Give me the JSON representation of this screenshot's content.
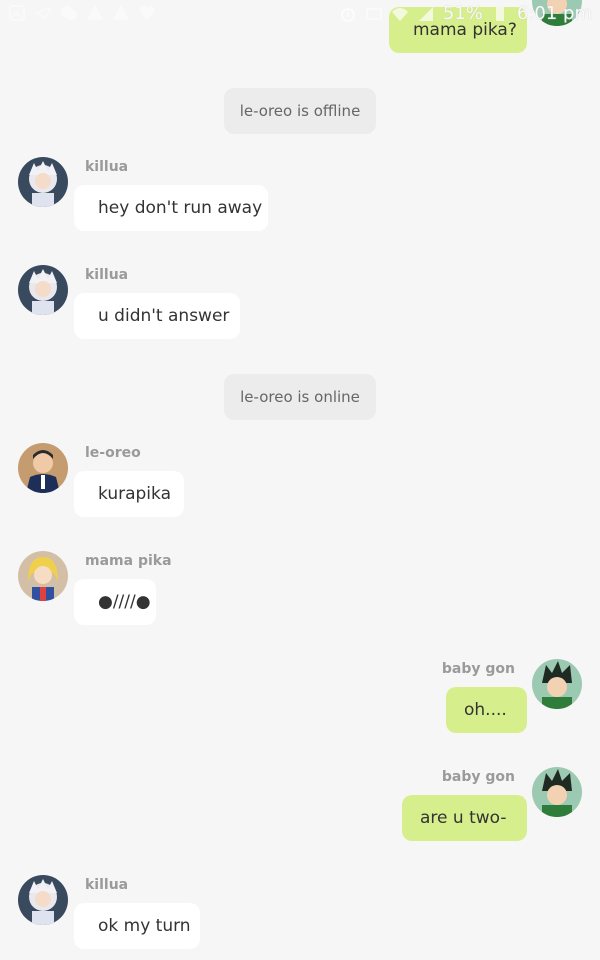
{
  "status_bar": {
    "battery": "51%",
    "time": "6:01 pm",
    "icons": [
      "gallery-icon",
      "messenger-icon",
      "chat-icon",
      "alert-icon",
      "alert-icon",
      "heart-icon",
      "alarm-icon",
      "lte-icon",
      "wifi-icon",
      "signal-icon",
      "battery-icon"
    ]
  },
  "messages": [
    {
      "kind": "outgoing",
      "text": "mama pika?",
      "avatar": "gon-avatar"
    },
    {
      "kind": "system",
      "text": "le-oreo is offline"
    },
    {
      "kind": "incoming",
      "sender": "killua",
      "text": "hey don't run away",
      "avatar": "killua-avatar"
    },
    {
      "kind": "incoming",
      "sender": "killua",
      "text": "u didn't answer",
      "avatar": "killua-avatar"
    },
    {
      "kind": "system",
      "text": "le-oreo is online"
    },
    {
      "kind": "incoming",
      "sender": "le-oreo",
      "text": "kurapika",
      "avatar": "leorio-avatar"
    },
    {
      "kind": "incoming",
      "sender": "mama pika",
      "text": "●////●",
      "avatar": "kurapika-avatar"
    },
    {
      "kind": "outgoing",
      "sender": "baby gon",
      "text": "oh....",
      "avatar": "gon-avatar"
    },
    {
      "kind": "outgoing",
      "sender": "baby gon",
      "text": "are u two-",
      "avatar": "gon-avatar"
    },
    {
      "kind": "incoming",
      "sender": "killua",
      "text": "ok my turn",
      "avatar": "killua-avatar"
    }
  ],
  "colors": {
    "background": "#f6f6f6",
    "incoming_bubble": "#ffffff",
    "outgoing_bubble": "#d7ee8c",
    "system_bubble": "#ececec",
    "sender_name": "#9a9a9a"
  }
}
